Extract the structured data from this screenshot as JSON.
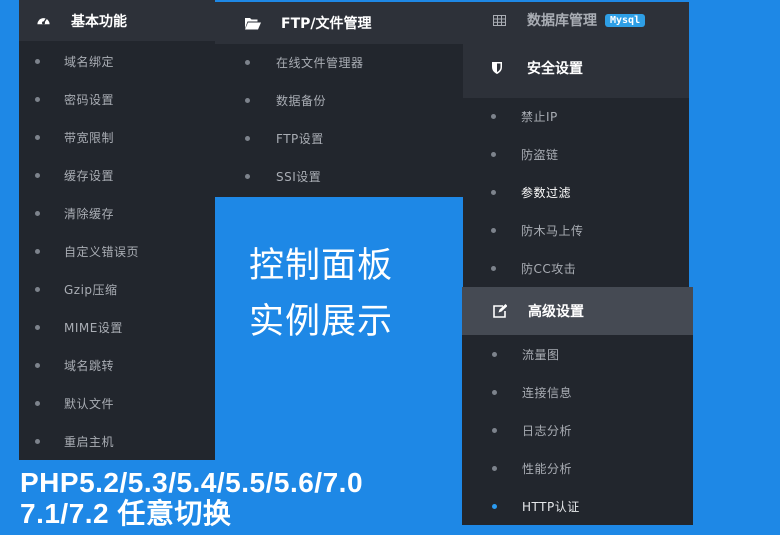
{
  "menus": {
    "basic": {
      "title": "基本功能",
      "icon": "dashboard-icon",
      "items": [
        "域名绑定",
        "密码设置",
        "带宽限制",
        "缓存设置",
        "清除缓存",
        "自定义错误页",
        "Gzip压缩",
        "MIME设置",
        "域名跳转",
        "默认文件",
        "重启主机"
      ]
    },
    "ftp": {
      "title": "FTP/文件管理",
      "icon": "folder-open-icon",
      "items": [
        "在线文件管理器",
        "数据备份",
        "FTP设置",
        "SSI设置"
      ]
    },
    "database": {
      "title": "数据库管理",
      "icon": "table-icon",
      "badge": "Mysql"
    },
    "security": {
      "title": "安全设置",
      "icon": "shield-icon",
      "items": [
        "禁止IP",
        "防盗链",
        "参数过滤",
        "防木马上传",
        "防CC攻击"
      ]
    },
    "advanced": {
      "title": "高级设置",
      "icon": "edit-icon",
      "items": [
        "流量图",
        "连接信息",
        "日志分析",
        "性能分析",
        "HTTP认证"
      ]
    }
  },
  "promo": {
    "line1": "控制面板",
    "line2": "实例展示"
  },
  "php_versions": {
    "line1": "PHP5.2/5.3/5.4/5.5/5.6/7.0",
    "line2": "7.1/7.2 任意切换"
  },
  "colors": {
    "background": "#1e88e6",
    "panel": "#22262d",
    "header": "#2d3139",
    "header_active": "#454a53",
    "badge": "#2e9fe6",
    "active_dot": "#2b9af0"
  }
}
